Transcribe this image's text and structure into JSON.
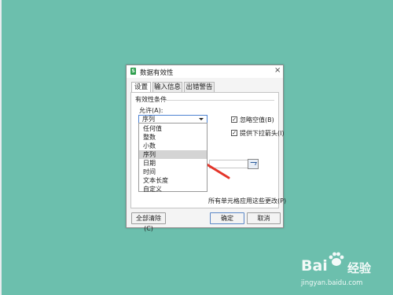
{
  "dialog": {
    "title": "数据有效性",
    "close_glyph": "×",
    "tabs": [
      {
        "label": "设置",
        "active": true
      },
      {
        "label": "输入信息",
        "active": false
      },
      {
        "label": "出错警告",
        "active": false
      }
    ],
    "section_label": "有效性条件",
    "allow_label": "允许(A):",
    "allow_value": "序列",
    "dropdown_options": [
      "任何值",
      "整数",
      "小数",
      "序列",
      "日期",
      "时间",
      "文本长度",
      "自定义"
    ],
    "dropdown_selected": "序列",
    "checkbox_ignore_blank": {
      "label": "忽略空值(B)",
      "checked": true,
      "mark": "✓"
    },
    "checkbox_dropdown_arrow": {
      "label": "提供下拉箭头(I)",
      "checked": true,
      "mark": "✓"
    },
    "apply_all_text": "所有单元格应用这些更改(P)",
    "buttons": {
      "clear_all": "全部清除(C)",
      "ok": "确定",
      "cancel": "取消"
    }
  },
  "colors": {
    "background": "#6cbfad",
    "annotation_arrow": "#e4352a",
    "select_border": "#4e83d2"
  },
  "watermark": {
    "brand": "Bai",
    "brand_suffix": "经验",
    "url": "jingyan.baidu.com"
  }
}
